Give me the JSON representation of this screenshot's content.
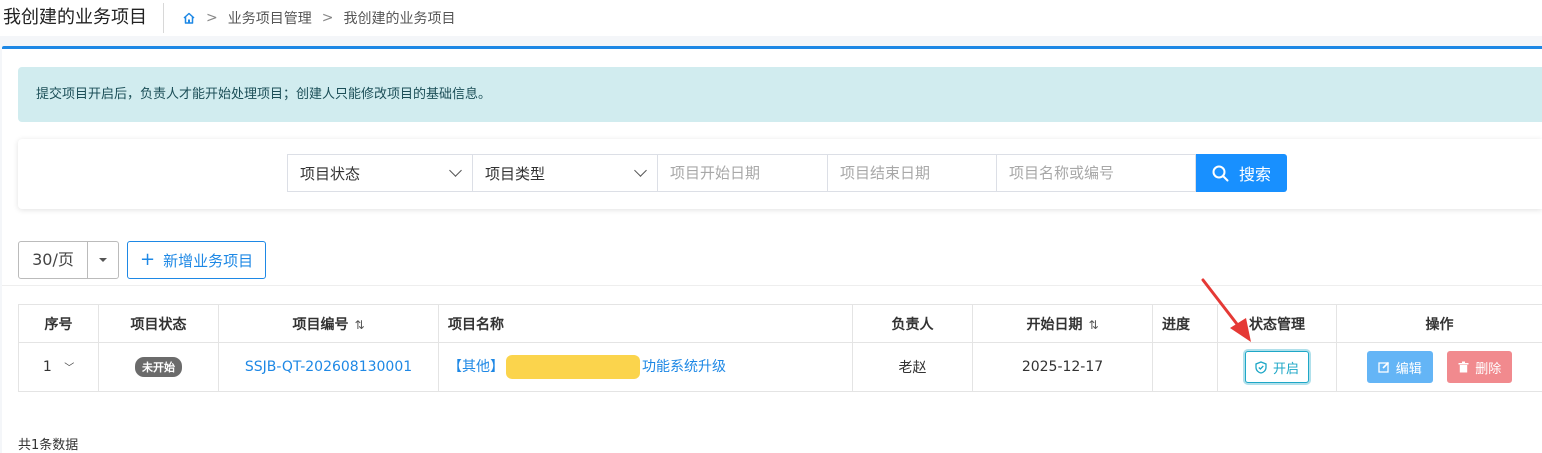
{
  "header": {
    "page_title": "我创建的业务项目",
    "breadcrumb": [
      "业务项目管理",
      "我创建的业务项目"
    ]
  },
  "alert": {
    "text": "提交项目开启后，负责人才能开始处理项目；创建人只能修改项目的基础信息。"
  },
  "filters": {
    "status_select": "项目状态",
    "type_select": "项目类型",
    "start_date_placeholder": "项目开始日期",
    "end_date_placeholder": "项目结束日期",
    "name_placeholder": "项目名称或编号",
    "search_label": "搜索"
  },
  "toolbar": {
    "page_size": "30/页",
    "add_label": "新增业务项目"
  },
  "table": {
    "headers": [
      "序号",
      "项目状态",
      "项目编号",
      "项目名称",
      "负责人",
      "开始日期",
      "进度",
      "状态管理",
      "操作"
    ],
    "rows": [
      {
        "index": "1",
        "status": "未开始",
        "code": "SSJB-QT-202608130001",
        "name_prefix": "【其他】",
        "name_suffix": "功能系统升级",
        "owner": "老赵",
        "start_date": "2025-12-17",
        "progress": "",
        "open_label": "开启",
        "edit_label": "编辑",
        "delete_label": "删除"
      }
    ]
  },
  "footer": {
    "total_text": "共1条数据"
  },
  "colors": {
    "primary": "#1890ff",
    "open": "#1ea7c7",
    "edit": "#64b5f6",
    "delete": "#f18a8e",
    "alert_bg": "#d1ecef",
    "annotation_arrow": "#e53935"
  }
}
